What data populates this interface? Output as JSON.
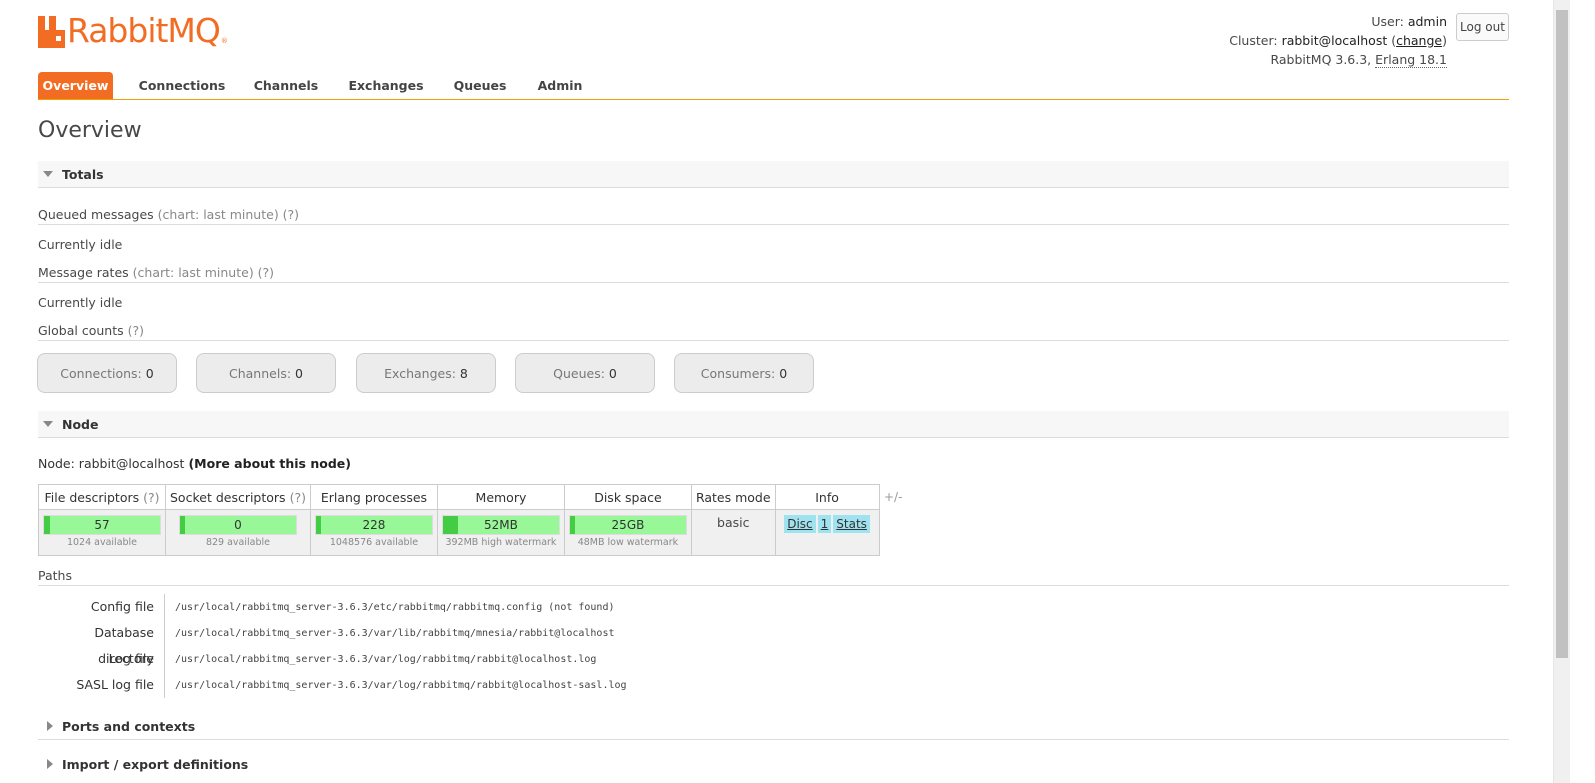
{
  "header": {
    "logo_text": "RabbitMQ",
    "logo_reg": "®",
    "user_label": "User:",
    "user_name": "admin",
    "cluster_label": "Cluster:",
    "cluster_name": "rabbit@localhost",
    "cluster_change": "change",
    "version": "RabbitMQ 3.6.3,",
    "erlang": "Erlang 18.1",
    "logout_label": "Log out"
  },
  "tabs": [
    {
      "label": "Overview"
    },
    {
      "label": "Connections"
    },
    {
      "label": "Channels"
    },
    {
      "label": "Exchanges"
    },
    {
      "label": "Queues"
    },
    {
      "label": "Admin"
    }
  ],
  "page_title": "Overview",
  "totals": {
    "heading": "Totals",
    "queued_label": "Queued messages",
    "queued_hint": "(chart: last minute) (?)",
    "idle1": "Currently idle",
    "rates_label": "Message rates",
    "rates_hint": "(chart: last minute) (?)",
    "idle2": "Currently idle",
    "global_label": "Global counts",
    "global_hint": "(?)",
    "counts": [
      {
        "label": "Connections:",
        "value": "0"
      },
      {
        "label": "Channels:",
        "value": "0"
      },
      {
        "label": "Exchanges:",
        "value": "8"
      },
      {
        "label": "Queues:",
        "value": "0"
      },
      {
        "label": "Consumers:",
        "value": "0"
      }
    ]
  },
  "node": {
    "heading": "Node",
    "node_label": "Node: rabbit@localhost",
    "more_link": "(More about this node)",
    "columns": {
      "file": "File descriptors",
      "socket": "Socket descriptors",
      "erlang": "Erlang processes",
      "memory": "Memory",
      "disk": "Disk space",
      "rates": "Rates mode",
      "info": "Info",
      "q": "(?)"
    },
    "file": {
      "value": "57",
      "sub": "1024 available",
      "fraction": 0.056
    },
    "socket": {
      "value": "0",
      "sub": "829 available",
      "fraction": 0.0
    },
    "erlang": {
      "value": "228",
      "sub": "1048576 available",
      "fraction": 0.0
    },
    "memory": {
      "value": "52MB",
      "sub": "392MB high watermark",
      "fraction": 0.13
    },
    "disk": {
      "value": "25GB",
      "sub": "48MB low watermark",
      "fraction": 0.0
    },
    "rates_mode": "basic",
    "info_tags": [
      "Disc",
      "1",
      "Stats"
    ],
    "plus_minus": "+/-"
  },
  "paths": {
    "title": "Paths",
    "rows": [
      {
        "label": "Config file",
        "value": "/usr/local/rabbitmq_server-3.6.3/etc/rabbitmq/rabbitmq.config (not found)"
      },
      {
        "label": "Database directory",
        "value": "/usr/local/rabbitmq_server-3.6.3/var/lib/rabbitmq/mnesia/rabbit@localhost"
      },
      {
        "label": "Log file",
        "value": "/usr/local/rabbitmq_server-3.6.3/var/log/rabbitmq/rabbit@localhost.log"
      },
      {
        "label": "SASL log file",
        "value": "/usr/local/rabbitmq_server-3.6.3/var/log/rabbitmq/rabbit@localhost-sasl.log"
      }
    ]
  },
  "collapsed": {
    "ports": "Ports and contexts",
    "import": "Import / export definitions"
  },
  "colors": {
    "brand": "#f26c23",
    "bar_green": "#98f898",
    "info_blue": "#9fe3f0"
  }
}
